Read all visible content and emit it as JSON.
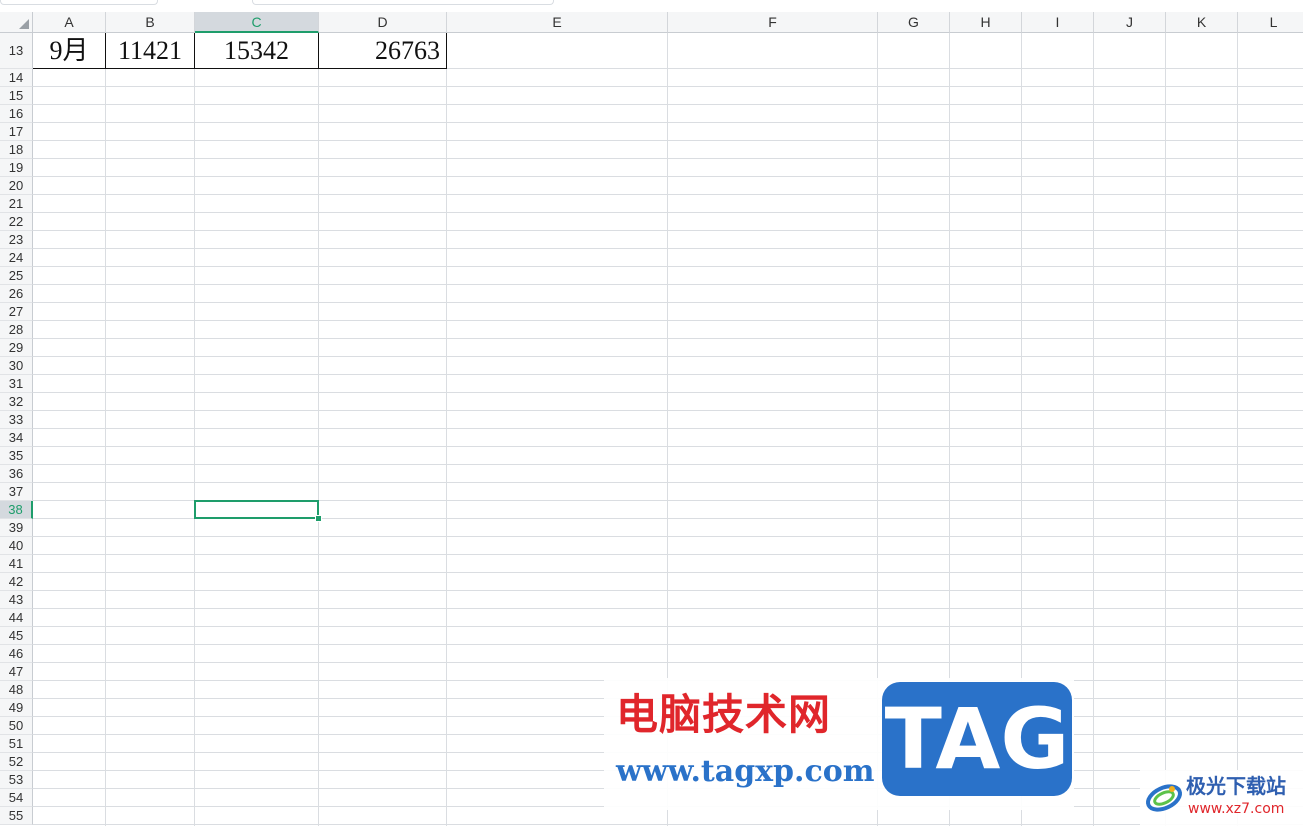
{
  "sheet": {
    "columns": [
      {
        "label": "A",
        "width": 73
      },
      {
        "label": "B",
        "width": 89
      },
      {
        "label": "C",
        "width": 124
      },
      {
        "label": "D",
        "width": 128
      },
      {
        "label": "E",
        "width": 221
      },
      {
        "label": "F",
        "width": 210
      },
      {
        "label": "G",
        "width": 72
      },
      {
        "label": "H",
        "width": 72
      },
      {
        "label": "I",
        "width": 72
      },
      {
        "label": "J",
        "width": 72
      },
      {
        "label": "K",
        "width": 72
      },
      {
        "label": "L",
        "width": 72
      }
    ],
    "rows": [
      "13",
      "14",
      "15",
      "16",
      "17",
      "18",
      "19",
      "20",
      "21",
      "22",
      "23",
      "24",
      "25",
      "26",
      "27",
      "28",
      "29",
      "30",
      "31",
      "32",
      "33",
      "34",
      "35",
      "36",
      "37",
      "38",
      "39",
      "40",
      "41",
      "42",
      "43",
      "44",
      "45",
      "46",
      "47",
      "48",
      "49",
      "50",
      "51",
      "52",
      "53",
      "54",
      "55"
    ],
    "selected_column": "C",
    "selected_row": "38",
    "active_cell": "C38",
    "row13": [
      {
        "col": "A",
        "value": "9月",
        "align": "center"
      },
      {
        "col": "B",
        "value": "11421",
        "align": "center"
      },
      {
        "col": "C",
        "value": "15342",
        "align": "center"
      },
      {
        "col": "D",
        "value": "26763",
        "align": "right"
      }
    ]
  },
  "watermark": {
    "site_name_cn": "电脑技术网",
    "site_url": "www.tagxp.com",
    "tag_logo": "TAG",
    "secondary_name_cn": "极光下载站",
    "secondary_url": "www.xz7.com",
    "colors": {
      "red": "#e0262b",
      "blue": "#2a72c9",
      "grid": "#dadde1",
      "accent_green": "#1e9d6b"
    }
  }
}
